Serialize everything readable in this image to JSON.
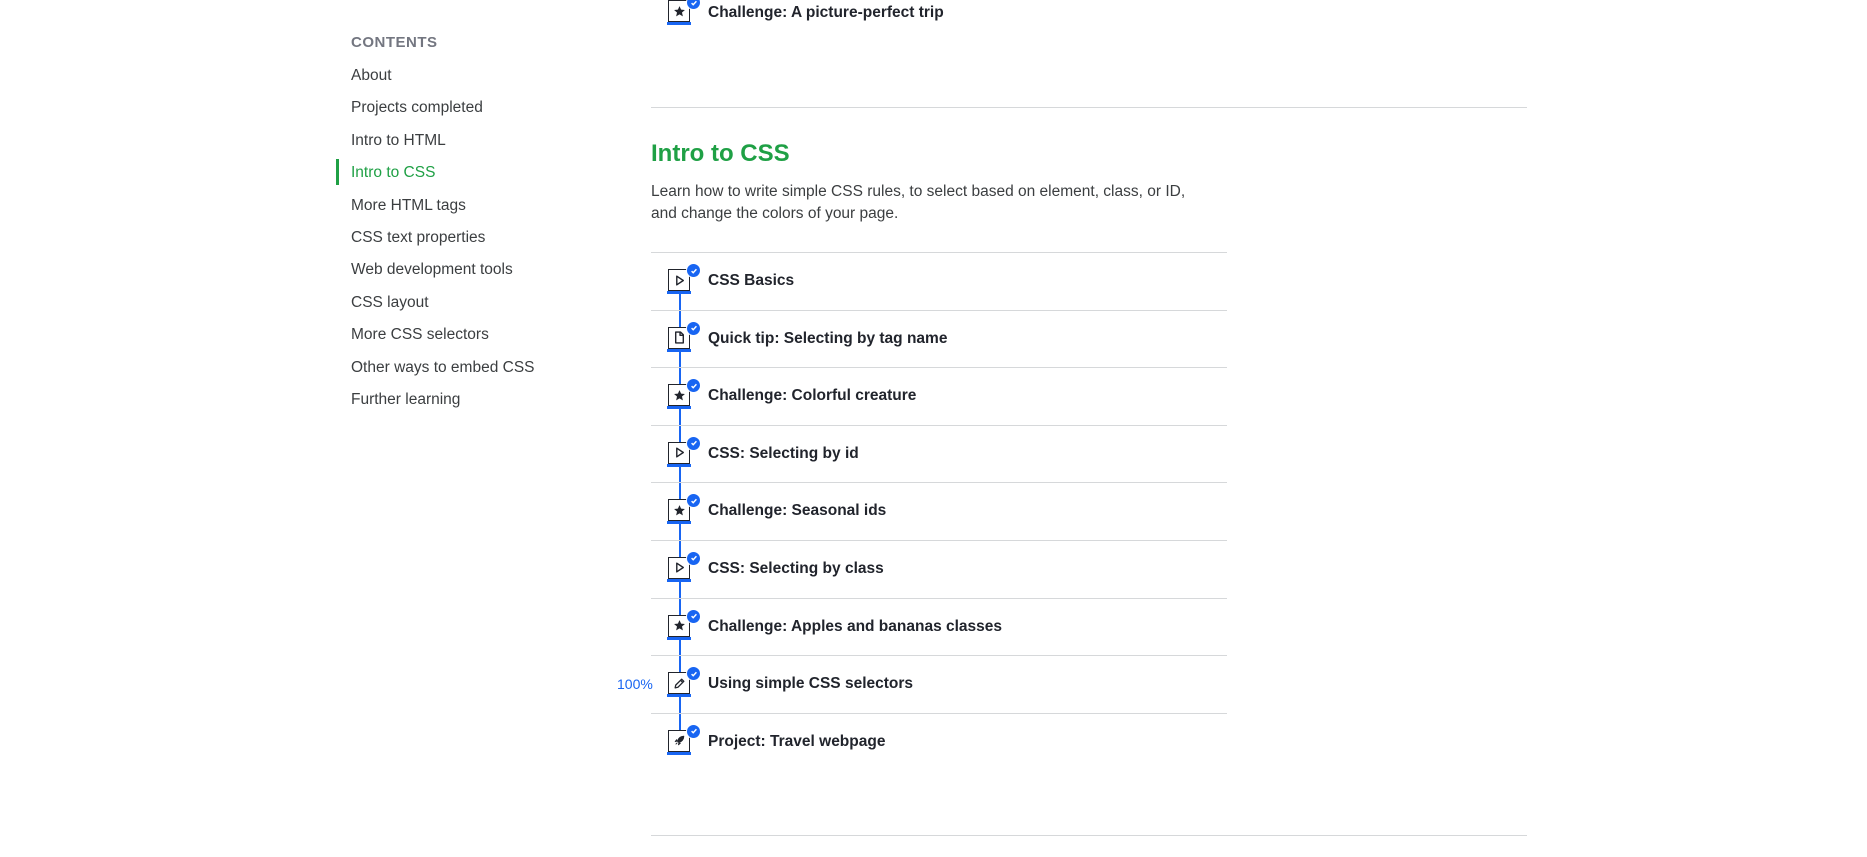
{
  "sidebar": {
    "heading": "CONTENTS",
    "items": [
      {
        "label": "About"
      },
      {
        "label": "Projects completed"
      },
      {
        "label": "Intro to HTML"
      },
      {
        "label": "Intro to CSS",
        "active": true
      },
      {
        "label": "More HTML tags"
      },
      {
        "label": "CSS text properties"
      },
      {
        "label": "Web development tools"
      },
      {
        "label": "CSS layout"
      },
      {
        "label": "More CSS selectors"
      },
      {
        "label": "Other ways to embed CSS"
      },
      {
        "label": "Further learning"
      }
    ]
  },
  "previous_section": {
    "last_lesson": {
      "title": "Challenge: A picture-perfect trip",
      "icon": "star-icon"
    }
  },
  "section": {
    "title": "Intro to CSS",
    "description": "Learn how to write simple CSS rules, to select based on element, class, or ID, and change the colors of your page.",
    "lessons": [
      {
        "title": "CSS Basics",
        "icon": "play-icon",
        "completed": true
      },
      {
        "title": "Quick tip: Selecting by tag name",
        "icon": "document-icon",
        "completed": true
      },
      {
        "title": "Challenge: Colorful creature",
        "icon": "star-icon",
        "completed": true
      },
      {
        "title": "CSS: Selecting by id",
        "icon": "play-icon",
        "completed": true
      },
      {
        "title": "Challenge: Seasonal ids",
        "icon": "star-icon",
        "completed": true
      },
      {
        "title": "CSS: Selecting by class",
        "icon": "play-icon",
        "completed": true
      },
      {
        "title": "Challenge: Apples and bananas classes",
        "icon": "star-icon",
        "completed": true
      },
      {
        "title": "Using simple CSS selectors",
        "icon": "pencil-icon",
        "completed": true,
        "percent": "100%"
      },
      {
        "title": "Project: Travel webpage",
        "icon": "rocket-icon",
        "completed": true
      }
    ]
  },
  "colors": {
    "accent_green": "#1fa045",
    "progress_blue": "#1865f2",
    "text": "#21242c",
    "muted": "#737680",
    "divider": "#d6d8da"
  }
}
